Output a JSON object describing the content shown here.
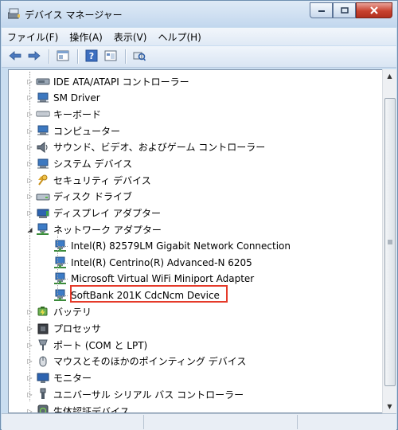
{
  "window": {
    "title": "デバイス マネージャー"
  },
  "menu": [
    {
      "label": "ファイル(F)"
    },
    {
      "label": "操作(A)"
    },
    {
      "label": "表示(V)"
    },
    {
      "label": "ヘルプ(H)"
    }
  ],
  "toolbar": [
    "back-icon",
    "forward-icon",
    "properties-icon",
    "help-icon",
    "show-hidden-icon",
    "scan-hardware-icon"
  ],
  "tree": [
    {
      "label": "IDE ATA/ATAPI コントローラー",
      "icon": "ide-controller-icon",
      "level": 0,
      "expander": "collapsed"
    },
    {
      "label": "SM Driver",
      "icon": "sm-driver-icon",
      "level": 0,
      "expander": "collapsed"
    },
    {
      "label": "キーボード",
      "icon": "keyboard-icon",
      "level": 0,
      "expander": "collapsed"
    },
    {
      "label": "コンピューター",
      "icon": "computer-icon",
      "level": 0,
      "expander": "collapsed"
    },
    {
      "label": "サウンド、ビデオ、およびゲーム コントローラー",
      "icon": "sound-icon",
      "level": 0,
      "expander": "collapsed"
    },
    {
      "label": "システム デバイス",
      "icon": "system-device-icon",
      "level": 0,
      "expander": "collapsed"
    },
    {
      "label": "セキュリティ デバイス",
      "icon": "security-device-icon",
      "level": 0,
      "expander": "collapsed"
    },
    {
      "label": "ディスク ドライブ",
      "icon": "disk-drive-icon",
      "level": 0,
      "expander": "collapsed"
    },
    {
      "label": "ディスプレイ アダプター",
      "icon": "display-adapter-icon",
      "level": 0,
      "expander": "collapsed"
    },
    {
      "label": "ネットワーク アダプター",
      "icon": "network-adapter-icon",
      "level": 0,
      "expander": "expanded"
    },
    {
      "label": "Intel(R) 82579LM Gigabit Network Connection",
      "icon": "network-adapter-icon",
      "level": 1,
      "expander": "none"
    },
    {
      "label": "Intel(R) Centrino(R) Advanced-N 6205",
      "icon": "network-adapter-icon",
      "level": 1,
      "expander": "none"
    },
    {
      "label": "Microsoft Virtual WiFi Miniport Adapter",
      "icon": "network-adapter-icon",
      "level": 1,
      "expander": "none"
    },
    {
      "label": "SoftBank 201K CdcNcm Device",
      "icon": "network-adapter-icon",
      "level": 1,
      "expander": "none",
      "highlighted": true
    },
    {
      "label": "バッテリ",
      "icon": "battery-icon",
      "level": 0,
      "expander": "collapsed"
    },
    {
      "label": "プロセッサ",
      "icon": "processor-icon",
      "level": 0,
      "expander": "collapsed"
    },
    {
      "label": "ポート (COM と LPT)",
      "icon": "port-icon",
      "level": 0,
      "expander": "collapsed"
    },
    {
      "label": "マウスとそのほかのポインティング デバイス",
      "icon": "mouse-icon",
      "level": 0,
      "expander": "collapsed"
    },
    {
      "label": "モニター",
      "icon": "monitor-icon",
      "level": 0,
      "expander": "collapsed"
    },
    {
      "label": "ユニバーサル シリアル バス コントローラー",
      "icon": "usb-icon",
      "level": 0,
      "expander": "collapsed"
    },
    {
      "label": "生体認証デバイス",
      "icon": "biometric-icon",
      "level": 0,
      "expander": "collapsed"
    }
  ],
  "colors": {
    "highlight_border": "#e53a2a",
    "window_frame": "#c9ddf0"
  }
}
